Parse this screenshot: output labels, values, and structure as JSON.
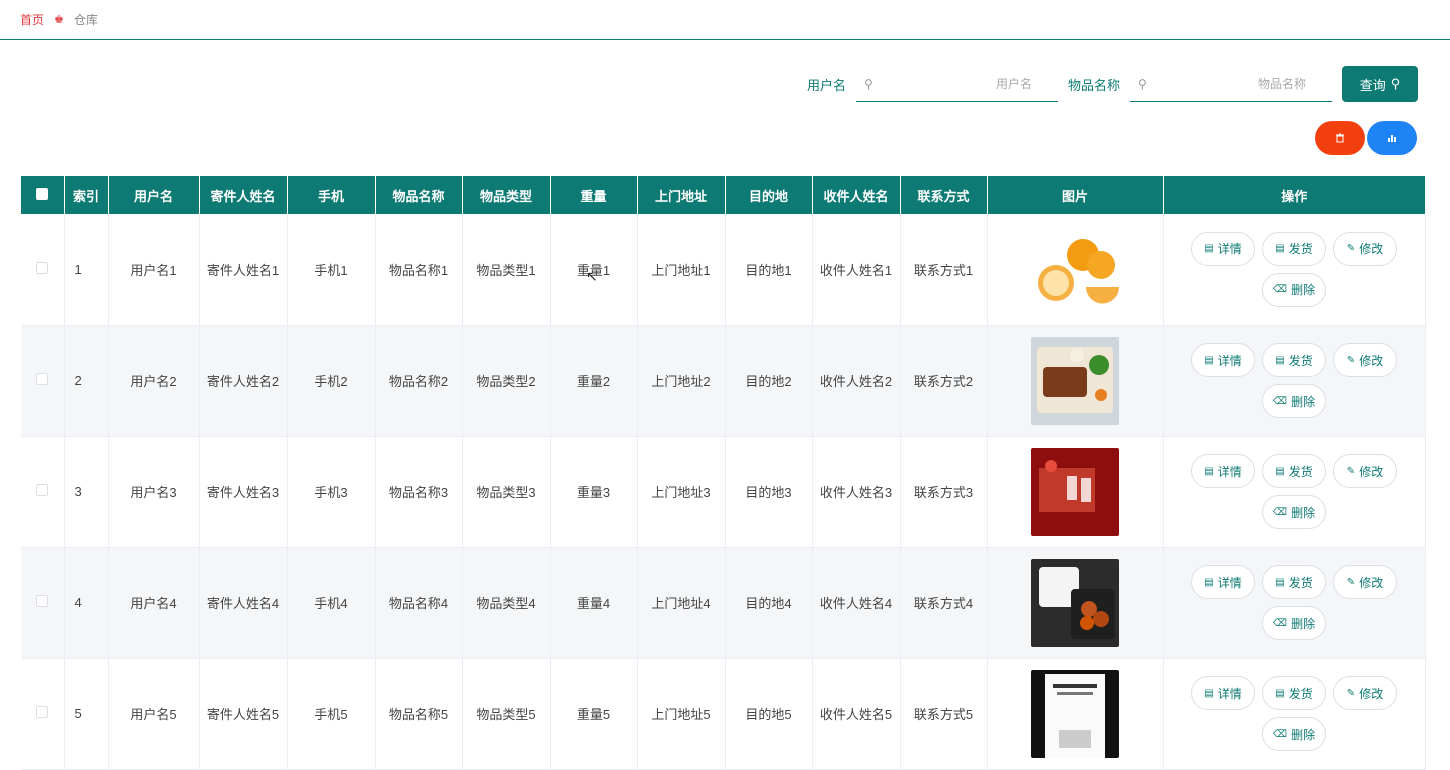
{
  "breadcrumb": {
    "home": "首页",
    "current": "仓库"
  },
  "search": {
    "username_label": "用户名",
    "username_placeholder": "用户名",
    "item_label": "物品名称",
    "item_placeholder": "物品名称",
    "query_label": "查询"
  },
  "colors": {
    "primary": "#0d7a73",
    "delete": "#f1400e",
    "stats": "#1e83f5",
    "home": "#e4393c"
  },
  "table": {
    "headers": [
      "索引",
      "用户名",
      "寄件人姓名",
      "手机",
      "物品名称",
      "物品类型",
      "重量",
      "上门地址",
      "目的地",
      "收件人姓名",
      "联系方式",
      "图片",
      "操作"
    ],
    "actions": {
      "detail": "详情",
      "ship": "发货",
      "edit": "修改",
      "delete": "删除"
    },
    "rows": [
      {
        "index": "1",
        "username": "用户名1",
        "sender": "寄件人姓名1",
        "phone": "手机1",
        "item_name": "物品名称1",
        "item_type": "物品类型1",
        "weight": "重量1",
        "pickup": "上门地址1",
        "destination": "目的地1",
        "receiver": "收件人姓名1",
        "contact": "联系方式1",
        "image": "oranges"
      },
      {
        "index": "2",
        "username": "用户名2",
        "sender": "寄件人姓名2",
        "phone": "手机2",
        "item_name": "物品名称2",
        "item_type": "物品类型2",
        "weight": "重量2",
        "pickup": "上门地址2",
        "destination": "目的地2",
        "receiver": "收件人姓名2",
        "contact": "联系方式2",
        "image": "bento-meat"
      },
      {
        "index": "3",
        "username": "用户名3",
        "sender": "寄件人姓名3",
        "phone": "手机3",
        "item_name": "物品名称3",
        "item_type": "物品类型3",
        "weight": "重量3",
        "pickup": "上门地址3",
        "destination": "目的地3",
        "receiver": "收件人姓名3",
        "contact": "联系方式3",
        "image": "red-gift-box"
      },
      {
        "index": "4",
        "username": "用户名4",
        "sender": "寄件人姓名4",
        "phone": "手机4",
        "item_name": "物品名称4",
        "item_type": "物品类型4",
        "weight": "重量4",
        "pickup": "上门地址4",
        "destination": "目的地4",
        "receiver": "收件人姓名4",
        "contact": "联系方式4",
        "image": "rice-chicken"
      },
      {
        "index": "5",
        "username": "用户名5",
        "sender": "寄件人姓名5",
        "phone": "手机5",
        "item_name": "物品名称5",
        "item_type": "物品类型5",
        "weight": "重量5",
        "pickup": "上门地址5",
        "destination": "目的地5",
        "receiver": "收件人姓名5",
        "contact": "联系方式5",
        "image": "book"
      }
    ]
  }
}
